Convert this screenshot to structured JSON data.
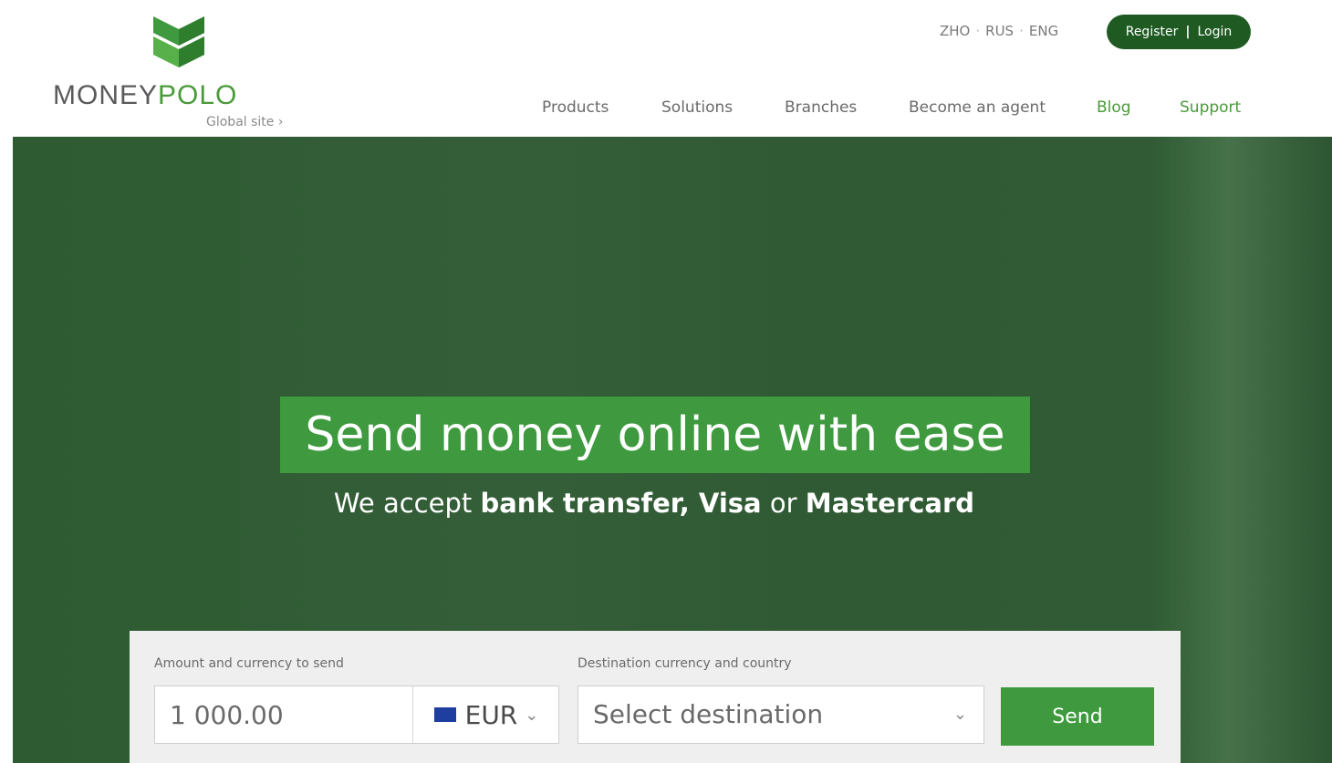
{
  "brand": {
    "name_part1": "MONEY",
    "name_part2": "POLO",
    "global_link": "Global site ›"
  },
  "languages": [
    "ZHO",
    "RUS",
    "ENG"
  ],
  "lang_separator": "·",
  "auth": {
    "register": "Register",
    "separator": "|",
    "login": "Login"
  },
  "nav": [
    "Products",
    "Solutions",
    "Branches",
    "Become an agent",
    "Blog",
    "Support"
  ],
  "hero": {
    "headline": "Send money online with ease",
    "sub_prefix": "We accept ",
    "sub_bold1": "bank transfer, Visa",
    "sub_mid": " or ",
    "sub_bold2": "Mastercard"
  },
  "form": {
    "amount_label": "Amount and currency to send",
    "amount_value": "1 000.00",
    "currency": "EUR",
    "destination_label": "Destination currency and country",
    "destination_placeholder": "Select destination",
    "send_label": "Send"
  },
  "colors": {
    "brand_green": "#3f9a3f",
    "dark_green": "#1f5a23",
    "hero_bg": "#2f5a33"
  },
  "icons": {
    "logo_mark": "chevron-logo-icon",
    "currency_flag": "eu-flag-icon",
    "dropdown": "chevron-down-icon"
  }
}
